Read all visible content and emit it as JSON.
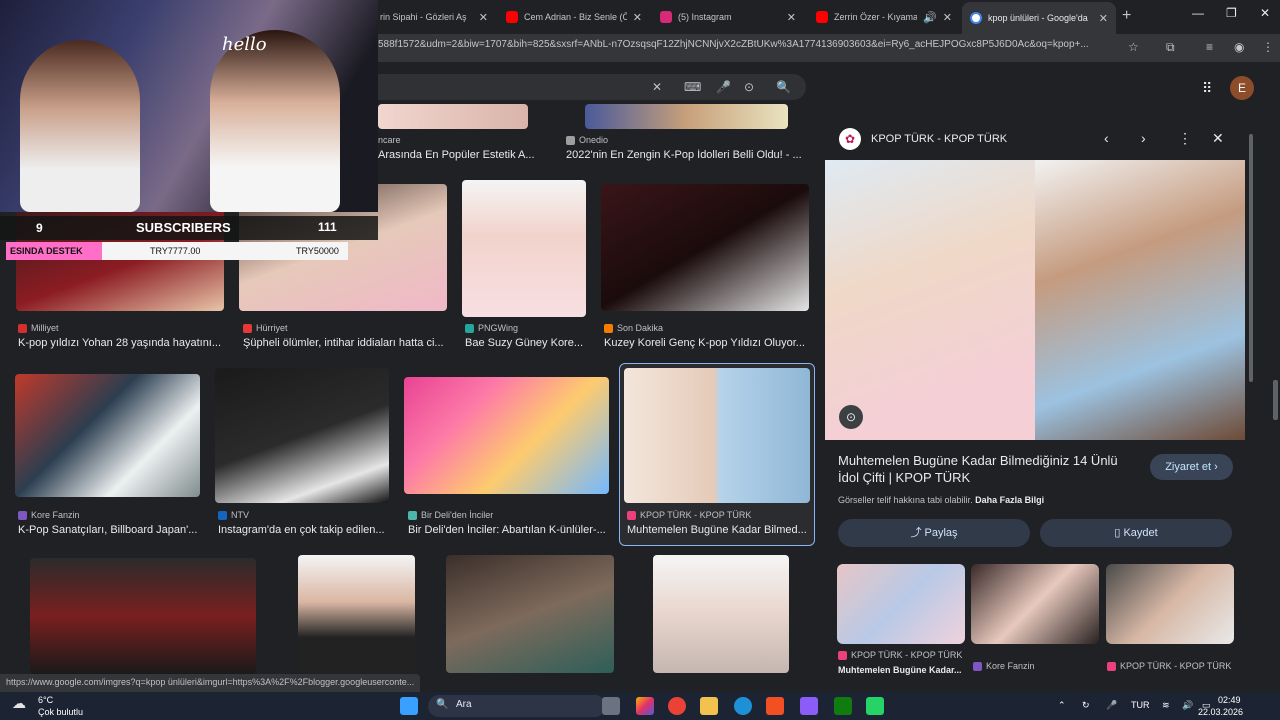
{
  "browser": {
    "tabs": [
      {
        "title": "rin Sipahi - Gözleri Aş",
        "color": "#cc0000"
      },
      {
        "title": "Cem Adrian - Biz Senle (Ö",
        "color": "#ff0000"
      },
      {
        "title": "(5) Instagram",
        "color": "#d62976"
      },
      {
        "title": "Zerrin Özer - Kıyamam",
        "color": "#ff0000"
      },
      {
        "title": "kpop ünlüleri - Google'da",
        "color": "#4285f4"
      }
    ],
    "url": "588f1572&udm=2&biw=1707&bih=825&sxsrf=ANbL-n7OzsqsqF12ZhjNCNNjvX2cZBtUKw%3A1774136903603&ei=Ry6_acHEJPOGxc8P5J6D0Ac&oq=kpop+..."
  },
  "google": {
    "avatar_letter": "E",
    "results": [
      {
        "source": "ncare",
        "caption": "Arasında En Popüler Estetik A...",
        "fav": "#888888"
      },
      {
        "source": "Onedio",
        "caption": "2022'nin En Zengin K-Pop İdolleri Belli Oldu! - ...",
        "fav": "#9e9e9e"
      },
      {
        "source": "Milliyet",
        "caption": "K-pop yıldızı Yohan 28 yaşında hayatını...",
        "fav": "#d32f2f"
      },
      {
        "source": "Hürriyet",
        "caption": "Şüpheli ölümler, intihar iddiaları hatta ci...",
        "fav": "#e53935"
      },
      {
        "source": "PNGWing",
        "caption": "Bae Suzy Güney Kore...",
        "fav": "#26a69a"
      },
      {
        "source": "Son Dakika",
        "caption": "Kuzey Koreli Genç K-pop Yıldızı Oluyor...",
        "fav": "#f57c00"
      },
      {
        "source": "Kore Fanzin",
        "caption": "K-Pop Sanatçıları, Billboard Japan'...",
        "fav": "#7e57c2"
      },
      {
        "source": "NTV",
        "caption": "Instagram'da en çok takip edilen...",
        "fav": "#1565c0"
      },
      {
        "source": "Bir Deli'den İnciler",
        "caption": "Bir Deli'den İnciler: Abartılan K-ünlüler-...",
        "fav": "#4db6ac"
      },
      {
        "source": "KPOP TÜRK - KPOP TÜRK",
        "caption": "Muhtemelen Bugüne Kadar Bilmed...",
        "fav": "#ec407a"
      }
    ],
    "status_url": "https://www.google.com/imgres?q=kpop ünlüleri&imgurl=https%3A%2F%2Fblogger.googleuserconte..."
  },
  "panel": {
    "source": "KPOP TÜRK - KPOP TÜRK",
    "title": "Muhtemelen Bugüne Kadar Bilmediğiniz 14 Ünlü İdol Çifti | KPOP TÜRK",
    "visit_label": "Ziyaret et",
    "notice": "Görseller telif hakkına tabi olabilir.",
    "notice_link": "Daha Fazla Bilgi",
    "share_label": "Paylaş",
    "save_label": "Kaydet",
    "related": [
      {
        "source": "KPOP TÜRK - KPOP TÜRK",
        "caption": "Muhtemelen Bugüne Kadar..."
      },
      {
        "source": "Kore Fanzin",
        "caption": ""
      },
      {
        "source": "KPOP TÜRK - KPOP TÜRK",
        "caption": ""
      }
    ]
  },
  "overlay": {
    "sub_count": "9",
    "subs_label": "SUBSCRIBERS",
    "subs_value": "111",
    "donate_label": "ESINDA DESTEK",
    "donate_amount": "TRY7777.00",
    "donate_goal": "TRY50000"
  },
  "taskbar": {
    "temp": "6°C",
    "condition": "Çok bulutlu",
    "search": "Ara",
    "lang": "TUR",
    "time": "02:49",
    "date": "22.03.2026"
  }
}
